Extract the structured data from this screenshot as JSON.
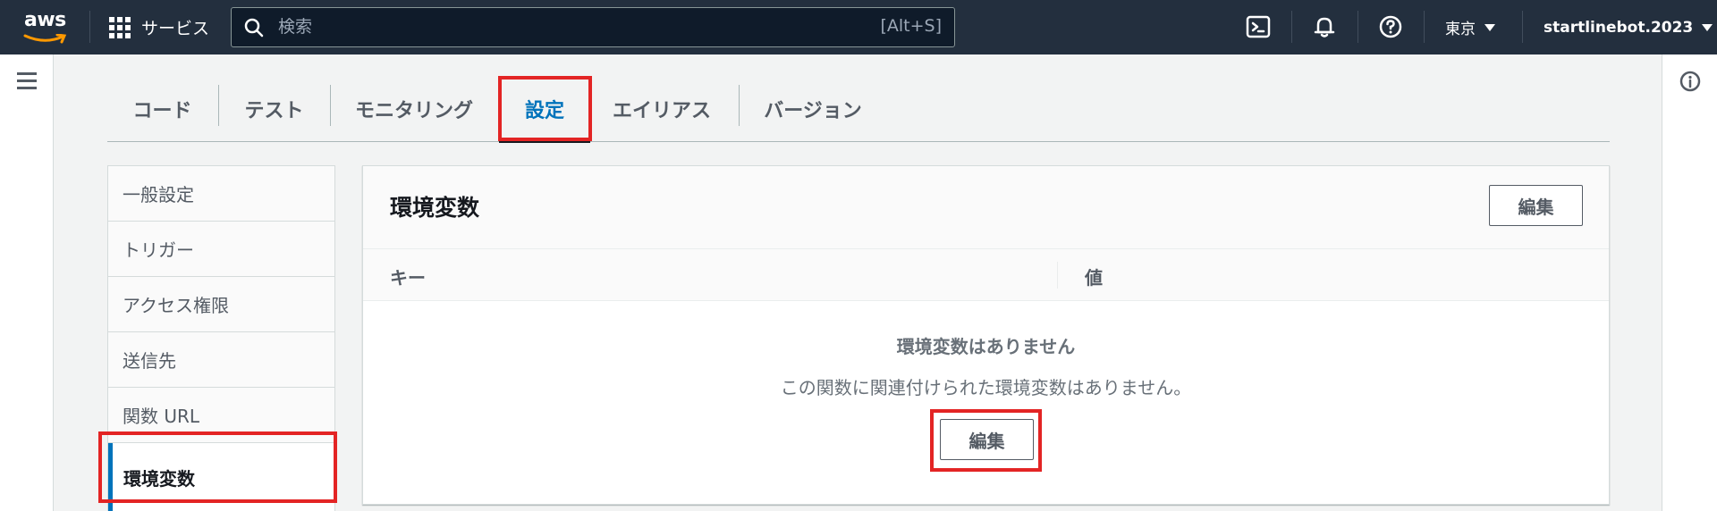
{
  "topnav": {
    "logo_text": "aws",
    "services_label": "サービス",
    "search_placeholder": "検索",
    "search_shortcut": "[Alt+S]",
    "region": "東京",
    "account": "startlinebot.2023"
  },
  "tabs": [
    {
      "label": "コード"
    },
    {
      "label": "テスト"
    },
    {
      "label": "モニタリング"
    },
    {
      "label": "設定",
      "active": true
    },
    {
      "label": "エイリアス"
    },
    {
      "label": "バージョン"
    }
  ],
  "sidemenu": {
    "items": [
      {
        "label": "一般設定"
      },
      {
        "label": "トリガー"
      },
      {
        "label": "アクセス権限"
      },
      {
        "label": "送信先"
      },
      {
        "label": "関数 URL"
      },
      {
        "label": "環境変数",
        "active": true
      }
    ]
  },
  "panel": {
    "title": "環境変数",
    "edit_label": "編集",
    "columns": [
      "キー",
      "値"
    ],
    "empty_title": "環境変数はありません",
    "empty_desc": "この関数に関連付けられた環境変数はありません。",
    "empty_edit_label": "編集"
  },
  "colors": {
    "nav_bg": "#232f3e",
    "accent": "#0073bb",
    "highlight": "#e32424"
  },
  "icons": [
    "grid-icon",
    "search-icon",
    "cloudshell-icon",
    "bell-icon",
    "help-icon",
    "hamburger-icon",
    "info-icon"
  ]
}
